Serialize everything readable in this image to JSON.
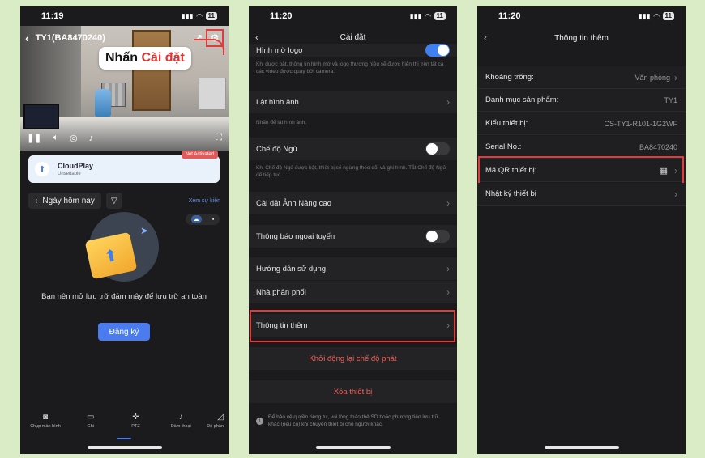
{
  "phone1": {
    "time": "11:19",
    "battery": "11",
    "device_title": "TY1(BA8470240)",
    "callout_prefix": "Nhấn",
    "callout_highlight": "Cài đặt",
    "cloudplay": {
      "name": "CloudPlay",
      "subtitle": "Unsettable",
      "badge": "Not Activated"
    },
    "date_label": "Ngày hôm nay",
    "events_link": "Xem sự kiện",
    "storage_message": "Bạn nên mở lưu trữ đám mây để lưu trữ an toàn",
    "register_label": "Đăng ký",
    "bottom_bar": [
      "Chụp màn hình",
      "Ghi",
      "PTZ",
      "Đàm thoại",
      "Độ phân"
    ]
  },
  "phone2": {
    "time": "11:20",
    "battery": "11",
    "nav_title": "Cài đặt",
    "logo_row": "Hình mờ logo",
    "logo_desc": "Khi được bật, thông tin hình mờ và logo thương hiệu sẽ được hiển thị trên tất cả các video được quay bởi camera.",
    "flip_row": "Lật hình ảnh",
    "flip_desc": "Nhấn để lật hình ảnh.",
    "sleep_row": "Chế độ Ngủ",
    "sleep_desc": "Khi Chế độ Ngủ được bật, thiết bị sẽ ngừng theo dõi và ghi hình. Tắt Chế độ Ngủ để tiếp tục.",
    "advanced_image_row": "Cài đặt Ảnh Nâng cao",
    "offline_notify_row": "Thông báo ngoại tuyến",
    "guide_row": "Hướng dẫn sử dụng",
    "distributor_row": "Nhà phân phối",
    "more_info_row": "Thông tin thêm",
    "restart_row": "Khởi động lại chế độ phát",
    "delete_row": "Xóa thiết bị",
    "privacy_notice": "Để bảo vệ quyền riêng tư, vui lòng tháo thẻ SD hoặc phương tiện lưu trữ khác (nếu có) khi chuyển thiết bị cho người khác."
  },
  "phone3": {
    "time": "11:20",
    "battery": "11",
    "nav_title": "Thông tin thêm",
    "rows": [
      {
        "label": "Khoảng trống:",
        "value": "Văn phòng"
      },
      {
        "label": "Danh mục sản phẩm:",
        "value": "TY1"
      },
      {
        "label": "Kiểu thiết bị:",
        "value": "CS-TY1-R101-1G2WF"
      },
      {
        "label": "Serial No.:",
        "value": "BA8470240"
      },
      {
        "label": "Mã QR thiết bị:",
        "value": ""
      },
      {
        "label": "Nhật ký thiết bị",
        "value": ""
      }
    ]
  },
  "colors": {
    "background": "#d9ecc6",
    "highlight": "#e23b3b",
    "accent": "#4a7bef",
    "danger": "#f0605a"
  }
}
